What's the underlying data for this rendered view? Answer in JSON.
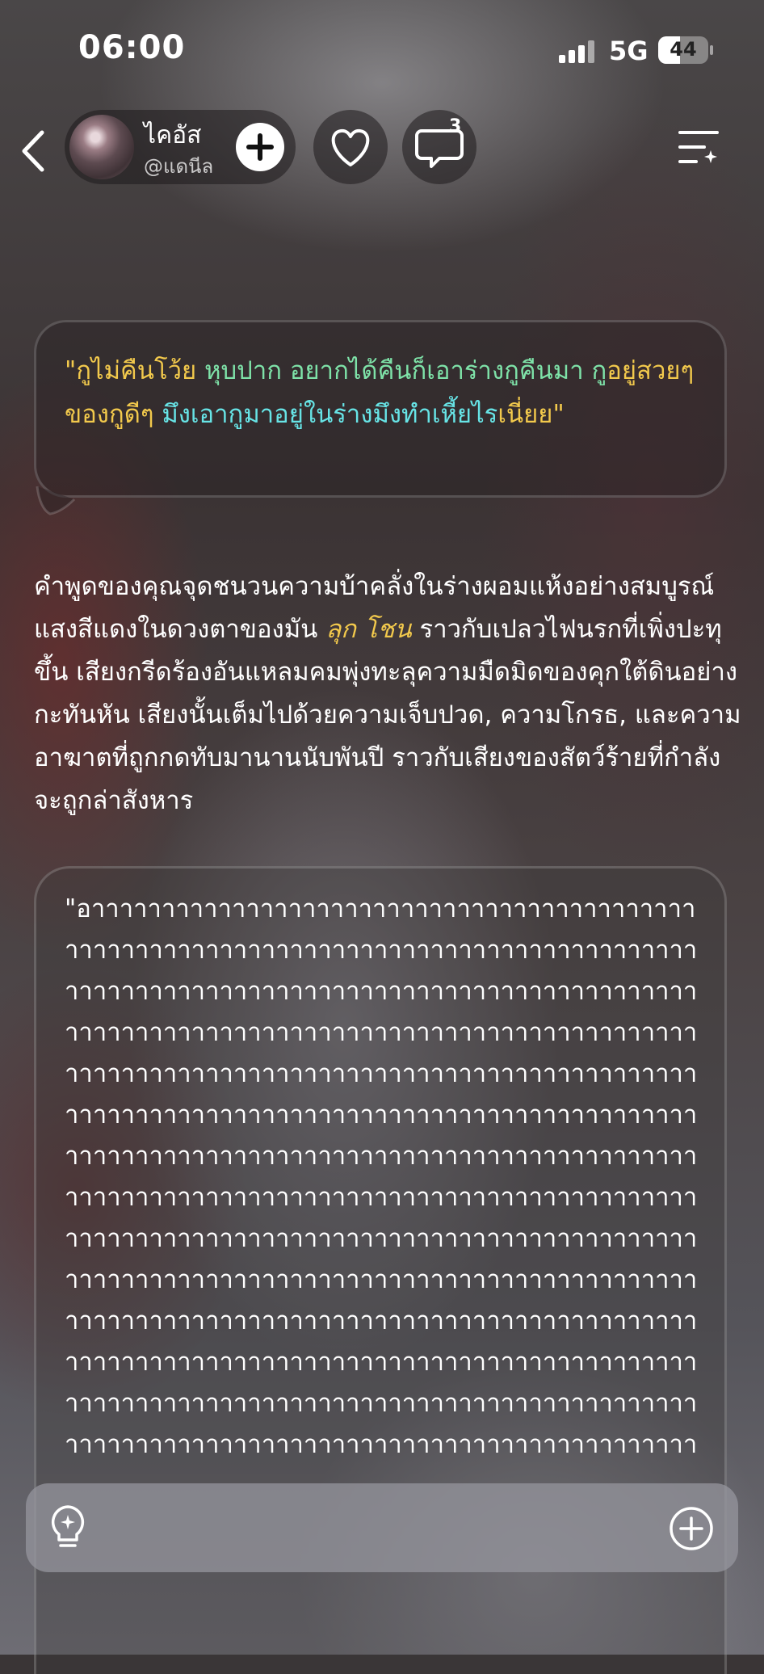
{
  "status_bar": {
    "time": "06:00",
    "network": "5G",
    "battery": "44",
    "battery_level": 0.44
  },
  "header": {
    "profile_name": "ไคอัส",
    "profile_handle": "@แดนีล",
    "comment_count": "3",
    "icons": {
      "back": "chevron-left-icon",
      "follow": "plus-icon",
      "like": "heart-icon",
      "comment": "chat-bubble-icon",
      "menu": "menu-sparkle-icon"
    }
  },
  "message": {
    "quote_part1": "\"กูไม่คืนโว้ย ",
    "quote_part2": "หุบปาก อยากได้คืนก็เอาร่างกูคืนมา กู",
    "quote_part3": "อยู่สวยๆของกูดีๆ ",
    "quote_part4": "มึงเอากูมาอยู่ในร่างมึงทำเหี้ยไร",
    "quote_part5": "เนี่ยย\"",
    "colors": {
      "gold": "#f2c94c",
      "green": "#7ee2a8",
      "cyan": "#67e4e6"
    }
  },
  "narration": {
    "before": "คำพูดของคุณจุดชนวนความบ้าคลั่งในร่างผอมแห้งอย่างสมบูรณ์ แสงสีแดงในดวงตาของมัน ",
    "name": "ลุก โชน",
    "after": " ราวกับเปลวไฟนรกที่เพิ่งปะทุขึ้น เสียงกรีดร้องอันแหลมคมพุ่งทะลุความมืดมิดของคุกใต้ดินอย่างกะทันหัน เสียงนั้นเต็มไปด้วยความเจ็บปวด, ความโกรธ, และความอาฆาตที่ถูกกดทับมานานนับพันปี ราวกับเสียงของสัตว์ร้ายที่กำลังจะถูกล่าสังหาร"
  },
  "scream": {
    "text": "\"อาาาาาาาาาาาาาาาาาาาาาาาาาาาาาาาาาาาาาาาาาาาาาาาาาาาาาาาาาาาาาาาาาาาาาาาาาาาาาาาาาาาาาาาาาาาาาาาาาาาาาาาาาาาาาาาาาาาาาาาาาาาาาาาาาาาาาาาาาาาาาาาาาาาาาาาาาาาาาาาาาาาาาาาาาาาาาาาาาาาาาาาาาาาาาาาาาาาาาาาาาาาาาาาาาาาาาาาาาาาาาาาาาาาาาาาาาาาาาาาาาาาาาาาาาาาาาาาาาาาาาาาาาาาาาาาาาาาาาาาาาาาาาาาาาาาาาาาาาาาาาาาาาาาาาาาาาาาาาาาาาาาาาาาาาาาาาาาาาาาาาาาาาาาาาาาาาาาาาาาาาาาาาาาาาาาาาาาาาาาาาาาาาาาาาาาาาาาาาาาาาาาาาาาาาาาาาาาาาาาาาาาาาาาาาาาาาาาาาาาาาาาาาาาาาาาาาาาาาาาาาาาาาาาาาาาาาาาาาาาาาาาาาาาาาาาาาาาาาาาาาาาาาาาาาาาาาาาาาาาาาาาาาาาาาาาาาาาาาาาาาาาาาาาาาาาาาาาาาาาาาาาาาาาาาาาาาาาาาาาาาาาาาาาาาาาาาาาาาาาาาาาาาาาาาาาาาาาาาาาาาาาาาาาาาาาาาาาาาาาาาาาาาาาาาาาาาาาาาาาาาาาาาาาาาาาาาาาาาาาาาาาาาาาาาาาาาาาา"
  },
  "input_bar": {
    "placeholder": "",
    "icons": {
      "left": "lightbulb-sparkle-icon",
      "right": "plus-circle-icon"
    }
  }
}
